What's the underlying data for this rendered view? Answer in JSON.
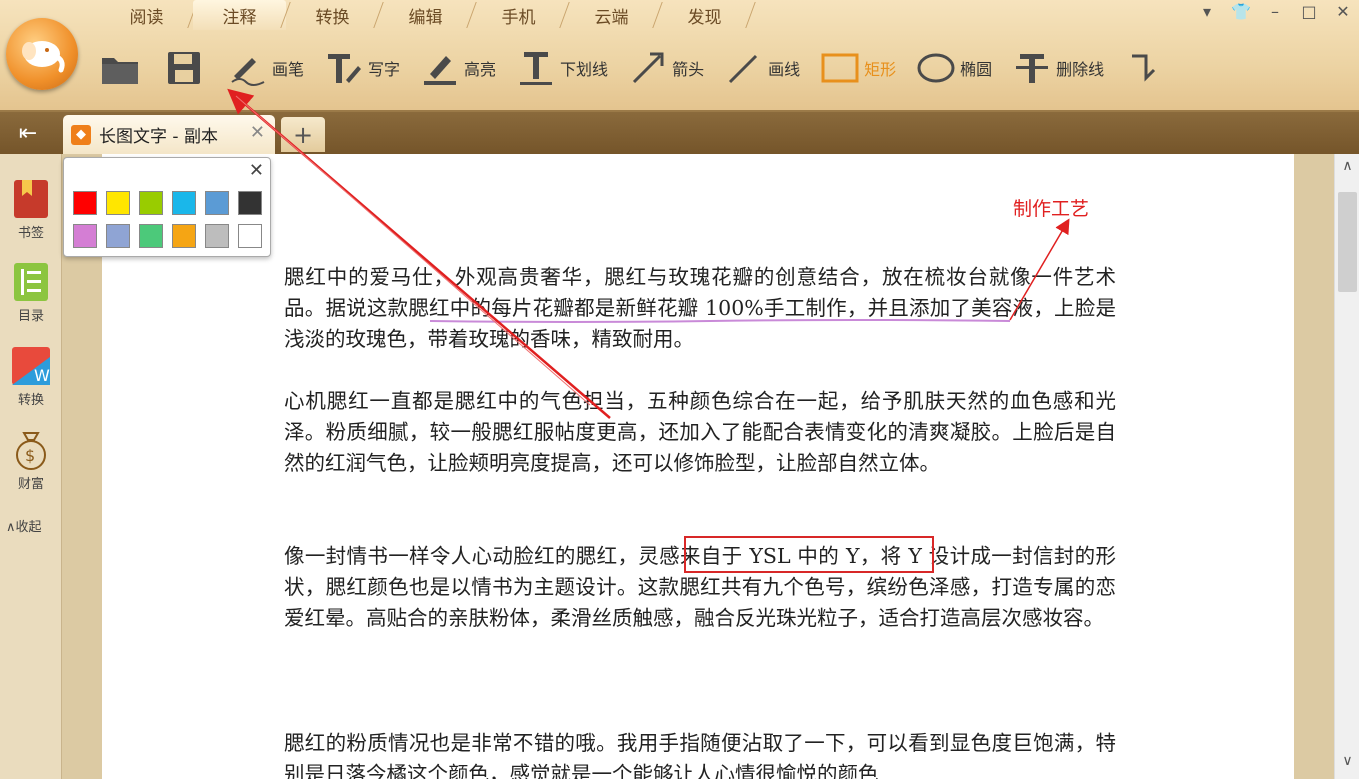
{
  "menu_tabs": [
    "阅读",
    "注释",
    "转换",
    "编辑",
    "手机",
    "云端",
    "发现"
  ],
  "active_menu_tab": "注释",
  "window_controls": {
    "dropdown": "▾",
    "skin": "👕",
    "minimize": "–",
    "maximize": "□",
    "close": "✕"
  },
  "toolbar": {
    "pen": "画笔",
    "text": "写字",
    "highlight": "高亮",
    "underline": "下划线",
    "arrow": "箭头",
    "line": "画线",
    "rect": "矩形",
    "ellipse": "椭圆",
    "strikethrough": "删除线"
  },
  "selected_tool": "rect",
  "document_tab": {
    "title": "长图文字 - 副本",
    "close": "✕",
    "add": "+"
  },
  "sidebar": {
    "bookmark": "书签",
    "toc": "目录",
    "convert": "转换",
    "wealth": "财富",
    "collapse": "∧收起"
  },
  "palette": {
    "close": "✕",
    "row1": [
      "#ff0000",
      "#ffe600",
      "#99cc00",
      "#1ab7ea",
      "#5b9bd5",
      "#333333"
    ],
    "row2": [
      "#d47ed4",
      "#8fa4d4",
      "#4cc97a",
      "#f5a514",
      "#bdbdbd",
      "#ffffff"
    ]
  },
  "annotation_text": "制作工艺",
  "paragraphs": [
    "腮红中的爱马仕，外观高贵奢华，腮红与玫瑰花瓣的创意结合，放在梳妆台就像一件艺术品。据说这款腮红中的每片花瓣都是新鲜花瓣 100%手工制作，并且添加了美容液，上脸是浅淡的玫瑰色，带着玫瑰的香味，精致耐用。",
    "心机腮红一直都是腮红中的气色担当，五种颜色综合在一起，给予肌肤天然的血色感和光泽。粉质细腻，较一般腮红服帖度更高，还加入了能配合表情变化的清爽凝胶。上脸后是自然的红润气色，让脸颊明亮度提高，还可以修饰脸型，让脸部自然立体。",
    "像一封情书一样令人心动脸红的腮红，灵感来自于 YSL 中的 Y，将 Y 设计成一封信封的形状，腮红颜色也是以情书为主题设计。这款腮红共有九个色号，缤纷色泽感，打造专属的恋爱红晕。高贴合的亲肤粉体，柔滑丝质触感，融合反光珠光粒子，适合打造高层次感妆容。",
    "腮红的粉质情况也是非常不错的哦。我用手指随便沾取了一下，可以看到显色度巨饱满，特别是日落今橘这个颜色，感觉就是一个能够让人心情很愉悦的颜色"
  ],
  "colors": {
    "accent": "#e8901c",
    "annotation_red": "#e02020",
    "underline_purple": "#c98ad8"
  }
}
